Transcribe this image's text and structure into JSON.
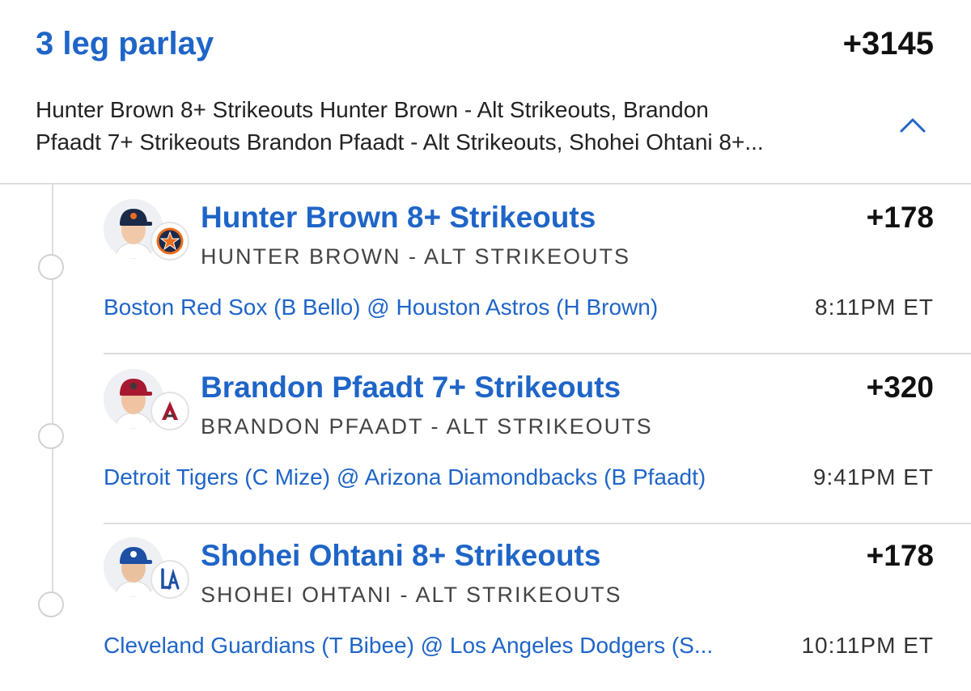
{
  "parlay": {
    "title": "3 leg parlay",
    "odds": "+3145",
    "description_line1": "Hunter Brown 8+ Strikeouts Hunter Brown - Alt Strikeouts, Brandon",
    "description_line2": "Pfaadt 7+ Strikeouts Brandon Pfaadt - Alt Strikeouts, Shohei Ohtani 8+..."
  },
  "legs": [
    {
      "title": "Hunter Brown 8+ Strikeouts",
      "odds": "+178",
      "subtitle": "HUNTER BROWN - ALT STRIKEOUTS",
      "matchup": "Boston Red Sox (B Bello) @ Houston Astros (H Brown)",
      "time": "8:11PM ET",
      "team_icon": "astros-logo-icon",
      "cap_color": "#1b2a48",
      "cap_accent": "#eb6e1f"
    },
    {
      "title": "Brandon Pfaadt 7+ Strikeouts",
      "odds": "+320",
      "subtitle": "BRANDON PFAADT - ALT STRIKEOUTS",
      "matchup": "Detroit Tigers (C Mize) @ Arizona Diamondbacks (B Pfaadt)",
      "time": "9:41PM ET",
      "team_icon": "diamondbacks-logo-icon",
      "cap_color": "#a71930",
      "cap_accent": "#3a3a3a"
    },
    {
      "title": "Shohei Ohtani 8+ Strikeouts",
      "odds": "+178",
      "subtitle": "SHOHEI OHTANI - ALT STRIKEOUTS",
      "matchup": "Cleveland Guardians (T Bibee) @ Los Angeles Dodgers (S...",
      "time": "10:11PM ET",
      "team_icon": "dodgers-logo-icon",
      "cap_color": "#1d4fa3",
      "cap_accent": "#ffffff"
    }
  ],
  "colors": {
    "accent_blue": "#1f65c8",
    "divider": "#dcdcdc"
  }
}
